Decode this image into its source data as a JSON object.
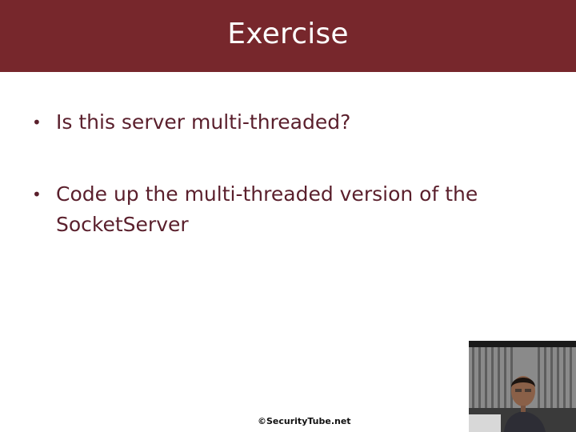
{
  "slide": {
    "title": "Exercise",
    "bullets": [
      {
        "text": "Is this server multi-threaded?"
      },
      {
        "text": "Code up the multi-threaded version of the SocketServer"
      }
    ],
    "footer": "©SecurityTube.net"
  },
  "webcam": {
    "content": "presenter video feed"
  },
  "colors": {
    "title_bar": "#77272c",
    "bullet_text": "#5a1f2c"
  }
}
